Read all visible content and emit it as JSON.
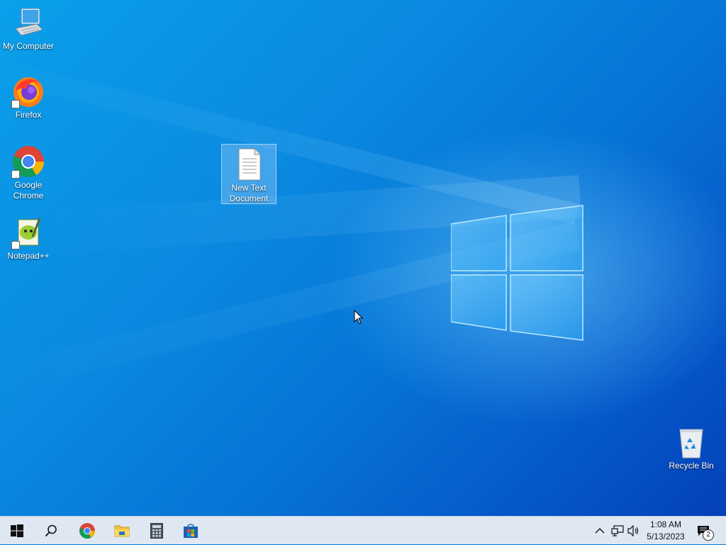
{
  "desktop": {
    "icons": [
      {
        "label": "My Computer",
        "icon": "computer-icon",
        "shortcut": false
      },
      {
        "label": "Firefox",
        "icon": "firefox-icon",
        "shortcut": true
      },
      {
        "label": "Google Chrome",
        "icon": "chrome-icon",
        "shortcut": true
      },
      {
        "label": "Notepad++",
        "icon": "notepadpp-icon",
        "shortcut": true
      },
      {
        "label": "New Text Document",
        "icon": "text-document-icon",
        "shortcut": false,
        "selected": true
      },
      {
        "label": "Recycle Bin",
        "icon": "recycle-bin-icon",
        "shortcut": false
      }
    ]
  },
  "taskbar": {
    "buttons": [
      {
        "name": "start",
        "icon": "windows-start-icon"
      },
      {
        "name": "search",
        "icon": "search-icon"
      },
      {
        "name": "chrome",
        "icon": "chrome-icon"
      },
      {
        "name": "file-explorer",
        "icon": "folder-icon"
      },
      {
        "name": "calculator",
        "icon": "calculator-icon"
      },
      {
        "name": "store",
        "icon": "store-icon"
      }
    ],
    "tray": {
      "icons": [
        "chevron-up-icon",
        "network-icon",
        "volume-icon"
      ],
      "time": "1:08 AM",
      "date": "5/13/2023",
      "notification_count": "2"
    }
  },
  "colors": {
    "accent": "#0078d7",
    "taskbar_bg": "#dfe7f2"
  }
}
